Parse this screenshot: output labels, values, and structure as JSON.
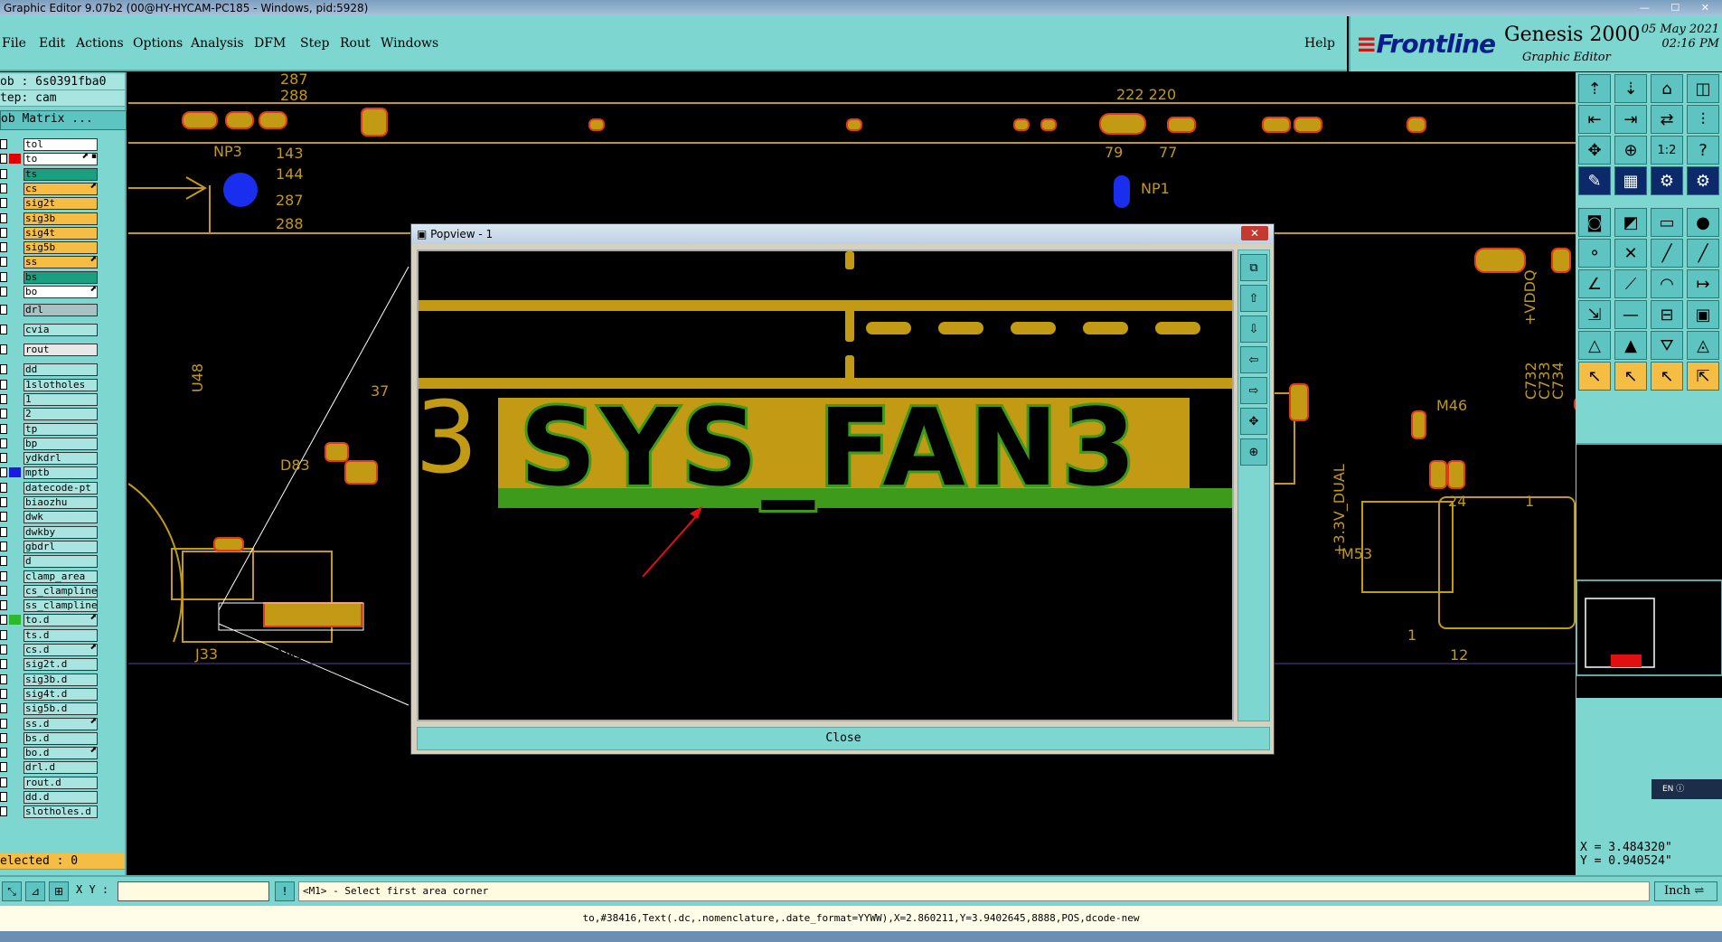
{
  "window": {
    "title": "Graphic Editor 9.07b2 (00@HY-HYCAM-PC185 - Windows, pid:5928)"
  },
  "menu": {
    "items": [
      "File",
      "Edit",
      "Actions",
      "Options",
      "Analysis",
      "DFM",
      "Step",
      "Rout",
      "Windows"
    ],
    "help": "Help"
  },
  "brand": {
    "logo": "Frontline",
    "product": "Genesis 2000",
    "subtitle": "Graphic Editor",
    "date": "05 May 2021",
    "time": "02:16 PM"
  },
  "left_panel": {
    "job": "ob : 6s0391fba0",
    "step": "tep: cam",
    "job_matrix": "ob Matrix ...",
    "selected": "elected : 0",
    "layers": [
      {
        "name": "tol",
        "color": "#ffffff",
        "sw": ""
      },
      {
        "name": "to",
        "color": "#ffffff",
        "sw": "#e00000",
        "flag": "⬈ ▪"
      },
      {
        "name": "ts",
        "color": "#1aa080",
        "sw": ""
      },
      {
        "name": "cs",
        "color": "#f5bd43",
        "sw": "",
        "flag": "⬈"
      },
      {
        "name": "sig2t",
        "color": "#f5bd43",
        "sw": ""
      },
      {
        "name": "sig3b",
        "color": "#f5bd43",
        "sw": ""
      },
      {
        "name": "sig4t",
        "color": "#f5bd43",
        "sw": ""
      },
      {
        "name": "sig5b",
        "color": "#f5bd43",
        "sw": ""
      },
      {
        "name": "ss",
        "color": "#f5bd43",
        "sw": "",
        "flag": "⬈"
      },
      {
        "name": "bs",
        "color": "#1aa080",
        "sw": ""
      },
      {
        "name": "bo",
        "color": "#ffffff",
        "sw": "",
        "flag": "⬈"
      },
      {
        "name": "drl",
        "color": "#a8c2c4",
        "sw": ""
      },
      {
        "name": "cvia",
        "color": "#a9e5e0",
        "sw": ""
      },
      {
        "name": "rout",
        "color": "#e8e8e8",
        "sw": ""
      },
      {
        "name": "dd",
        "color": "#a9e5e0",
        "sw": ""
      },
      {
        "name": "1slotholes",
        "color": "#a9e5e0",
        "sw": ""
      },
      {
        "name": "1",
        "color": "#a9e5e0",
        "sw": ""
      },
      {
        "name": "2",
        "color": "#a9e5e0",
        "sw": ""
      },
      {
        "name": "tp",
        "color": "#a9e5e0",
        "sw": ""
      },
      {
        "name": "bp",
        "color": "#a9e5e0",
        "sw": ""
      },
      {
        "name": "ydkdrl",
        "color": "#a9e5e0",
        "sw": ""
      },
      {
        "name": "mptb",
        "color": "#a9e5e0",
        "sw": "#1a1ae0"
      },
      {
        "name": "datecode-pt",
        "color": "#a9e5e0",
        "sw": ""
      },
      {
        "name": "biaozhu",
        "color": "#a9e5e0",
        "sw": ""
      },
      {
        "name": "dwk",
        "color": "#a9e5e0",
        "sw": ""
      },
      {
        "name": "dwkby",
        "color": "#a9e5e0",
        "sw": ""
      },
      {
        "name": "gbdrl",
        "color": "#a9e5e0",
        "sw": ""
      },
      {
        "name": "d",
        "color": "#a9e5e0",
        "sw": ""
      },
      {
        "name": "clamp_area",
        "color": "#a9e5e0",
        "sw": ""
      },
      {
        "name": "cs_clampline",
        "color": "#a9e5e0",
        "sw": ""
      },
      {
        "name": "ss_clampline",
        "color": "#a9e5e0",
        "sw": ""
      },
      {
        "name": "to.d",
        "color": "#a9e5e0",
        "sw": "#2db82d",
        "flag": "⬈"
      },
      {
        "name": "ts.d",
        "color": "#a9e5e0",
        "sw": ""
      },
      {
        "name": "cs.d",
        "color": "#a9e5e0",
        "sw": "",
        "flag": "⬈"
      },
      {
        "name": "sig2t.d",
        "color": "#a9e5e0",
        "sw": ""
      },
      {
        "name": "sig3b.d",
        "color": "#a9e5e0",
        "sw": ""
      },
      {
        "name": "sig4t.d",
        "color": "#a9e5e0",
        "sw": ""
      },
      {
        "name": "sig5b.d",
        "color": "#a9e5e0",
        "sw": ""
      },
      {
        "name": "ss.d",
        "color": "#a9e5e0",
        "sw": "",
        "flag": "⬈"
      },
      {
        "name": "bs.d",
        "color": "#a9e5e0",
        "sw": ""
      },
      {
        "name": "bo.d",
        "color": "#a9e5e0",
        "sw": "",
        "flag": "⬈"
      },
      {
        "name": "drl.d",
        "color": "#a9e5e0",
        "sw": ""
      },
      {
        "name": "rout.d",
        "color": "#a9e5e0",
        "sw": ""
      },
      {
        "name": "dd.d",
        "color": "#a9e5e0",
        "sw": ""
      },
      {
        "name": "slotholes.d",
        "color": "#a9e5e0",
        "sw": ""
      }
    ]
  },
  "canvas": {
    "labels": [
      "287",
      "288",
      "143",
      "144",
      "287",
      "288",
      "NP3",
      "222 220",
      "79",
      "77",
      "NP1",
      "U48",
      "37",
      "D83",
      "J33",
      "SYS_FAN3",
      "+VDDQ",
      "C732",
      "C733",
      "C734",
      "M46",
      "24",
      "1",
      "+3.3V_DUAL",
      "M53",
      "1",
      "12"
    ],
    "layer_color": "#c39a14",
    "outline_color": "#e03a1c"
  },
  "popview": {
    "title": "Popview - 1",
    "text": "SYS_FAN3",
    "close_label": "Close",
    "close_x": "✕"
  },
  "right_tools": {
    "icons": [
      "home-up-icon",
      "home-down-icon",
      "house-icon",
      "layers-icon",
      "left-icon",
      "right-icon",
      "swap-icon",
      "split-icon",
      "fit-icon",
      "center-icon",
      "ratio-icon",
      "help-icon",
      "pen-icon",
      "grid-icon",
      "snap-icon",
      "snap2-icon",
      "camera-icon",
      "select-icon",
      "ruler-icon",
      "dot-icon",
      "nodes-icon",
      "cross-icon",
      "line-icon",
      "line2-icon",
      "angle-icon",
      "diag-icon",
      "arc-icon",
      "arrowline-icon",
      "move-icon",
      "segment-icon",
      "measure-icon",
      "pad-icon",
      "triangle-icon",
      "tri2-icon",
      "tri3-icon",
      "tri4-icon",
      "pointer-icon",
      "pointer2-icon",
      "pointer3-icon",
      "pointer4-icon"
    ],
    "ratio_label": "1:2"
  },
  "coords": {
    "x": "X = 3.484320\"",
    "y": "Y = 0.940524\""
  },
  "language": "EN",
  "status": {
    "xy_label": "X Y :",
    "xy_value": "",
    "prompt": "<M1> - Select first area corner",
    "units": "Inch",
    "info": "to,#38416,Text(.dc,.nomenclature,.date_format=YYWW),X=2.860211,Y=3.9402645,8888,POS,dcode-new"
  }
}
